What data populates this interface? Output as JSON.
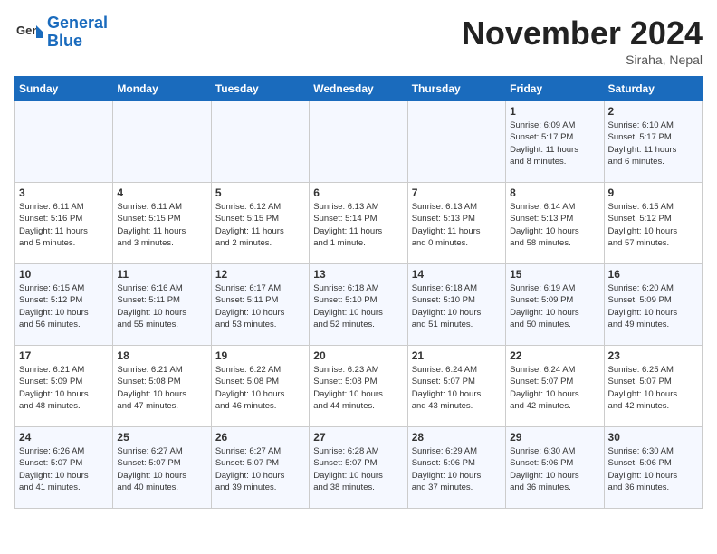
{
  "logo": {
    "line1": "General",
    "line2": "Blue"
  },
  "title": "November 2024",
  "location": "Siraha, Nepal",
  "weekdays": [
    "Sunday",
    "Monday",
    "Tuesday",
    "Wednesday",
    "Thursday",
    "Friday",
    "Saturday"
  ],
  "weeks": [
    [
      {
        "day": "",
        "info": ""
      },
      {
        "day": "",
        "info": ""
      },
      {
        "day": "",
        "info": ""
      },
      {
        "day": "",
        "info": ""
      },
      {
        "day": "",
        "info": ""
      },
      {
        "day": "1",
        "info": "Sunrise: 6:09 AM\nSunset: 5:17 PM\nDaylight: 11 hours\nand 8 minutes."
      },
      {
        "day": "2",
        "info": "Sunrise: 6:10 AM\nSunset: 5:17 PM\nDaylight: 11 hours\nand 6 minutes."
      }
    ],
    [
      {
        "day": "3",
        "info": "Sunrise: 6:11 AM\nSunset: 5:16 PM\nDaylight: 11 hours\nand 5 minutes."
      },
      {
        "day": "4",
        "info": "Sunrise: 6:11 AM\nSunset: 5:15 PM\nDaylight: 11 hours\nand 3 minutes."
      },
      {
        "day": "5",
        "info": "Sunrise: 6:12 AM\nSunset: 5:15 PM\nDaylight: 11 hours\nand 2 minutes."
      },
      {
        "day": "6",
        "info": "Sunrise: 6:13 AM\nSunset: 5:14 PM\nDaylight: 11 hours\nand 1 minute."
      },
      {
        "day": "7",
        "info": "Sunrise: 6:13 AM\nSunset: 5:13 PM\nDaylight: 11 hours\nand 0 minutes."
      },
      {
        "day": "8",
        "info": "Sunrise: 6:14 AM\nSunset: 5:13 PM\nDaylight: 10 hours\nand 58 minutes."
      },
      {
        "day": "9",
        "info": "Sunrise: 6:15 AM\nSunset: 5:12 PM\nDaylight: 10 hours\nand 57 minutes."
      }
    ],
    [
      {
        "day": "10",
        "info": "Sunrise: 6:15 AM\nSunset: 5:12 PM\nDaylight: 10 hours\nand 56 minutes."
      },
      {
        "day": "11",
        "info": "Sunrise: 6:16 AM\nSunset: 5:11 PM\nDaylight: 10 hours\nand 55 minutes."
      },
      {
        "day": "12",
        "info": "Sunrise: 6:17 AM\nSunset: 5:11 PM\nDaylight: 10 hours\nand 53 minutes."
      },
      {
        "day": "13",
        "info": "Sunrise: 6:18 AM\nSunset: 5:10 PM\nDaylight: 10 hours\nand 52 minutes."
      },
      {
        "day": "14",
        "info": "Sunrise: 6:18 AM\nSunset: 5:10 PM\nDaylight: 10 hours\nand 51 minutes."
      },
      {
        "day": "15",
        "info": "Sunrise: 6:19 AM\nSunset: 5:09 PM\nDaylight: 10 hours\nand 50 minutes."
      },
      {
        "day": "16",
        "info": "Sunrise: 6:20 AM\nSunset: 5:09 PM\nDaylight: 10 hours\nand 49 minutes."
      }
    ],
    [
      {
        "day": "17",
        "info": "Sunrise: 6:21 AM\nSunset: 5:09 PM\nDaylight: 10 hours\nand 48 minutes."
      },
      {
        "day": "18",
        "info": "Sunrise: 6:21 AM\nSunset: 5:08 PM\nDaylight: 10 hours\nand 47 minutes."
      },
      {
        "day": "19",
        "info": "Sunrise: 6:22 AM\nSunset: 5:08 PM\nDaylight: 10 hours\nand 46 minutes."
      },
      {
        "day": "20",
        "info": "Sunrise: 6:23 AM\nSunset: 5:08 PM\nDaylight: 10 hours\nand 44 minutes."
      },
      {
        "day": "21",
        "info": "Sunrise: 6:24 AM\nSunset: 5:07 PM\nDaylight: 10 hours\nand 43 minutes."
      },
      {
        "day": "22",
        "info": "Sunrise: 6:24 AM\nSunset: 5:07 PM\nDaylight: 10 hours\nand 42 minutes."
      },
      {
        "day": "23",
        "info": "Sunrise: 6:25 AM\nSunset: 5:07 PM\nDaylight: 10 hours\nand 42 minutes."
      }
    ],
    [
      {
        "day": "24",
        "info": "Sunrise: 6:26 AM\nSunset: 5:07 PM\nDaylight: 10 hours\nand 41 minutes."
      },
      {
        "day": "25",
        "info": "Sunrise: 6:27 AM\nSunset: 5:07 PM\nDaylight: 10 hours\nand 40 minutes."
      },
      {
        "day": "26",
        "info": "Sunrise: 6:27 AM\nSunset: 5:07 PM\nDaylight: 10 hours\nand 39 minutes."
      },
      {
        "day": "27",
        "info": "Sunrise: 6:28 AM\nSunset: 5:07 PM\nDaylight: 10 hours\nand 38 minutes."
      },
      {
        "day": "28",
        "info": "Sunrise: 6:29 AM\nSunset: 5:06 PM\nDaylight: 10 hours\nand 37 minutes."
      },
      {
        "day": "29",
        "info": "Sunrise: 6:30 AM\nSunset: 5:06 PM\nDaylight: 10 hours\nand 36 minutes."
      },
      {
        "day": "30",
        "info": "Sunrise: 6:30 AM\nSunset: 5:06 PM\nDaylight: 10 hours\nand 36 minutes."
      }
    ]
  ]
}
